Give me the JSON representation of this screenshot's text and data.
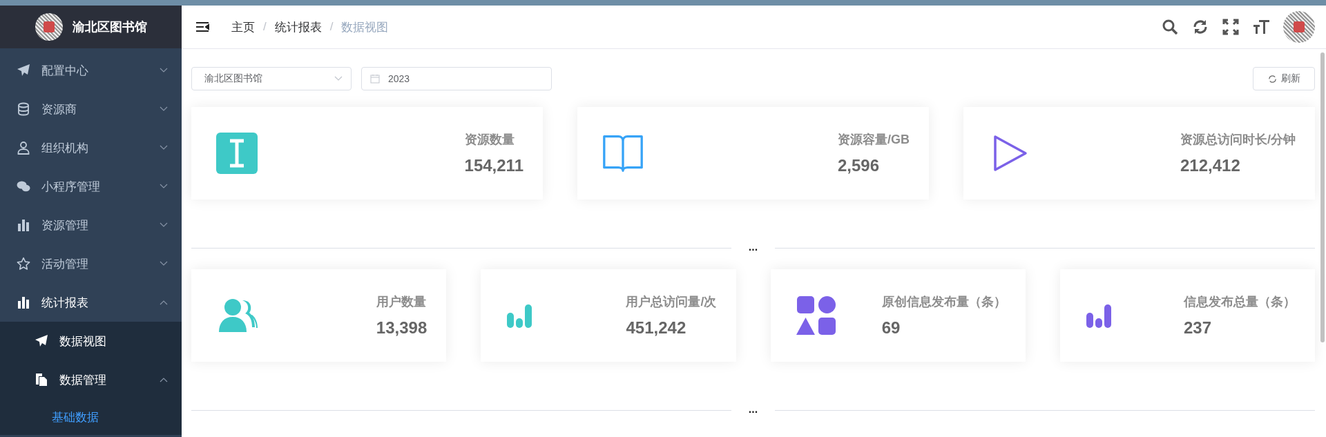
{
  "sidebar": {
    "title": "渝北区图书馆",
    "items": [
      {
        "label": "配置中心",
        "expanded": false
      },
      {
        "label": "资源商",
        "expanded": false
      },
      {
        "label": "组织机构",
        "expanded": false
      },
      {
        "label": "小程序管理",
        "expanded": false
      },
      {
        "label": "资源管理",
        "expanded": false
      },
      {
        "label": "活动管理",
        "expanded": false
      },
      {
        "label": "统计报表",
        "expanded": true,
        "children": [
          {
            "label": "数据视图",
            "selected": false
          },
          {
            "label": "数据管理",
            "expanded": true,
            "children": [
              {
                "label": "基础数据",
                "selected": true
              }
            ]
          }
        ]
      }
    ]
  },
  "breadcrumb": {
    "items": [
      "主页",
      "统计报表",
      "数据视图"
    ],
    "separators": [
      "/",
      "/"
    ]
  },
  "filters": {
    "library": "渝北区图书馆",
    "year": "2023",
    "refresh": "刷新"
  },
  "stat_rows": [
    [
      {
        "label": "资源数量",
        "value": "154,211",
        "color": "#3ec9c7"
      },
      {
        "label": "资源容量/GB",
        "value": "2,596",
        "color": "#36a3f7"
      },
      {
        "label": "资源总访问时长/分钟",
        "value": "212,412",
        "color": "#7b61e8"
      }
    ],
    [
      {
        "label": "用户数量",
        "value": "13,398",
        "color": "#3ec9c7"
      },
      {
        "label": "用户总访问量/次",
        "value": "451,242",
        "color": "#3ec9c7"
      },
      {
        "label": "原创信息发布量（条）",
        "value": "69",
        "color": "#7b61e8"
      },
      {
        "label": "信息发布总量（条）",
        "value": "237",
        "color": "#7b61e8"
      }
    ]
  ],
  "separators": [
    "...",
    "..."
  ]
}
